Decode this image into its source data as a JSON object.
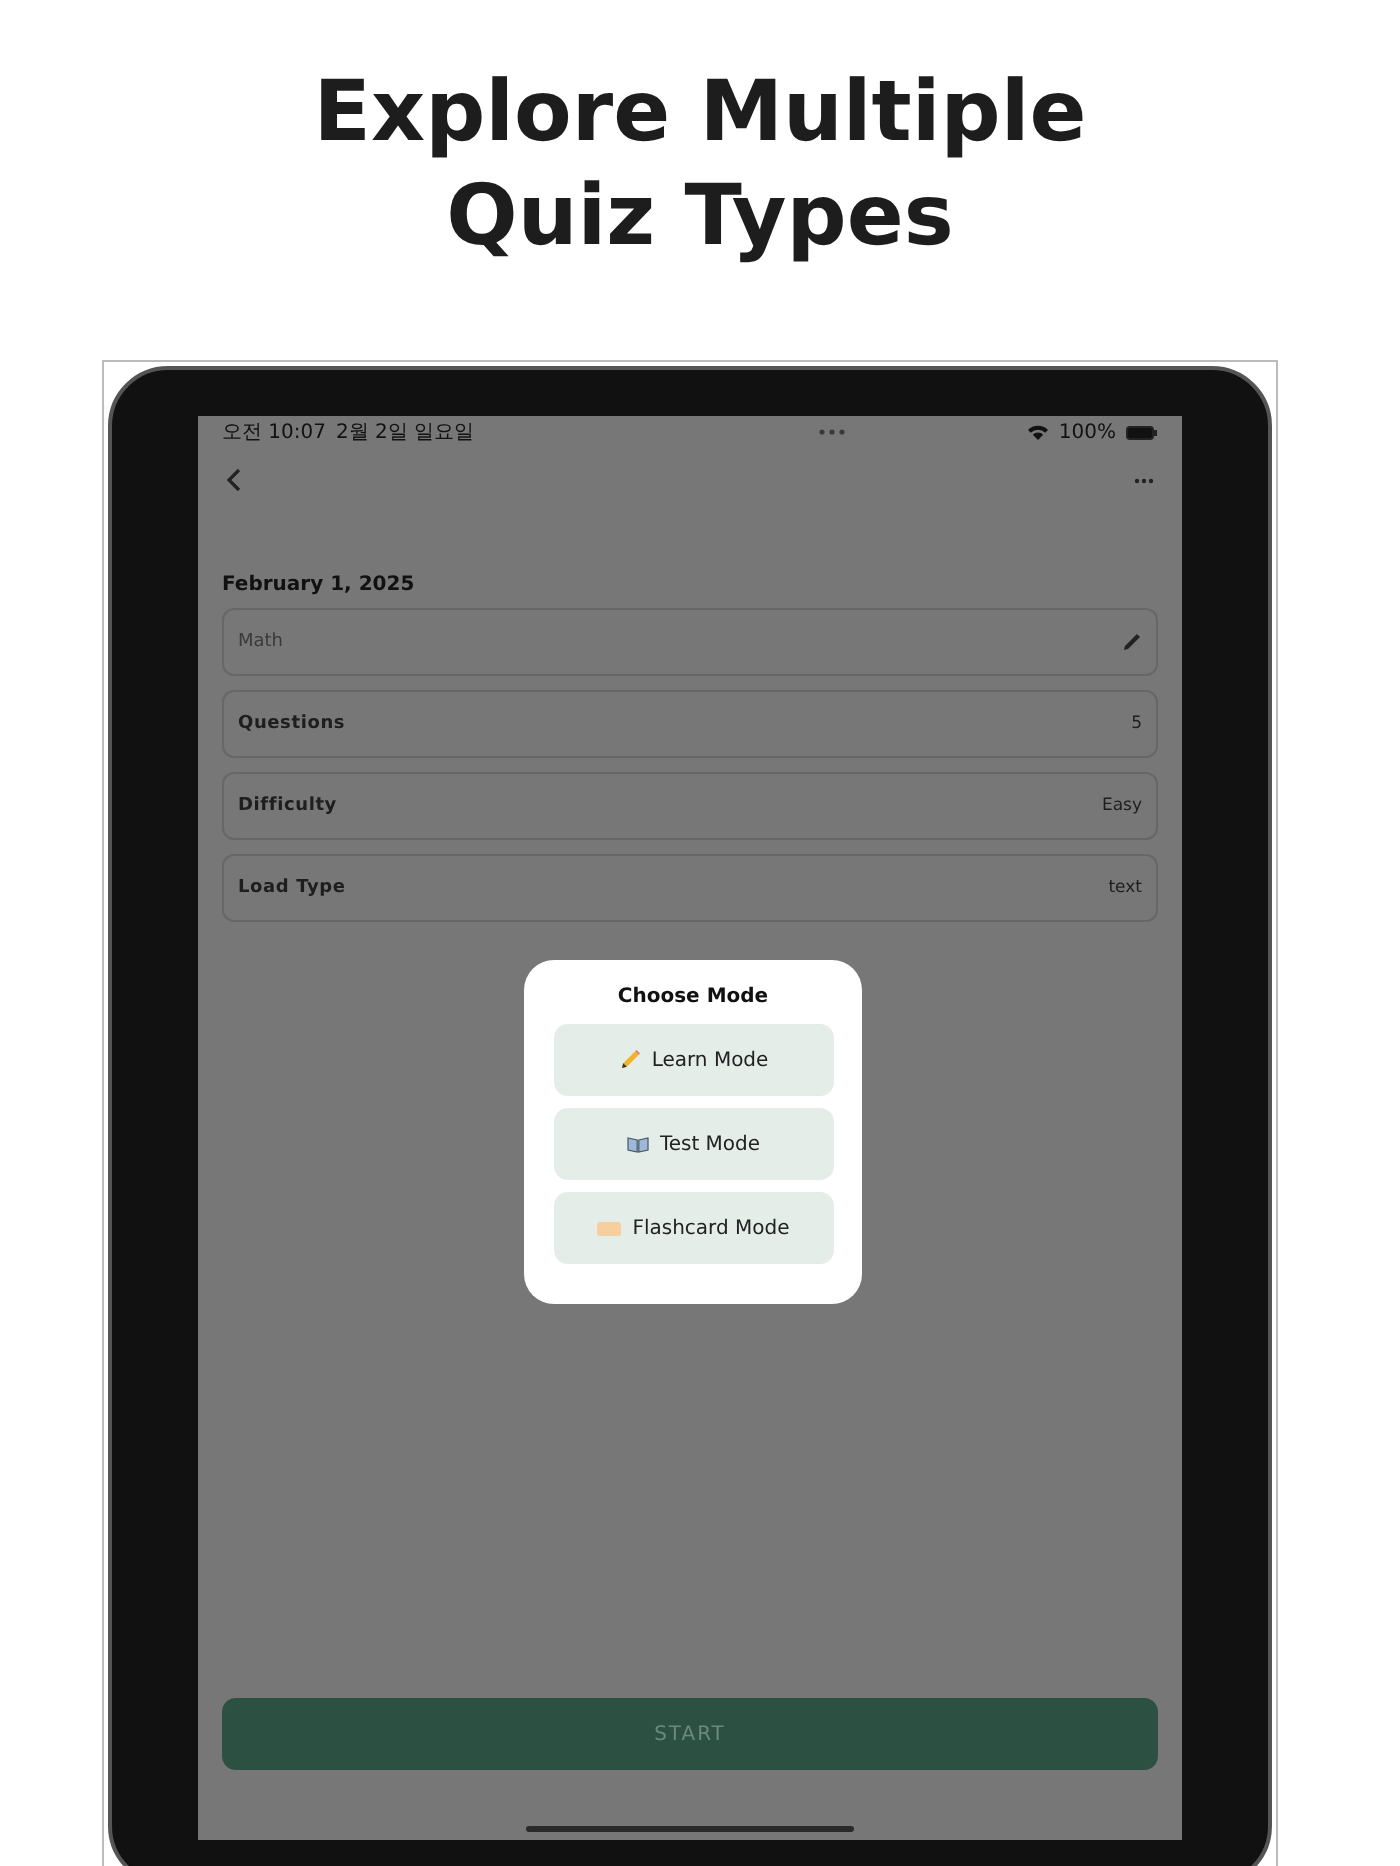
{
  "headline": [
    "Explore Multiple",
    "Quiz Types"
  ],
  "status_bar": {
    "time": "오전 10:07",
    "date": "2월 2일 일요일",
    "battery": "100%"
  },
  "date_heading": "February 1, 2025",
  "title_field": {
    "placeholder": "Math"
  },
  "settings": [
    {
      "label": "Questions",
      "value": "5"
    },
    {
      "label": "Difficulty",
      "value": "Easy"
    },
    {
      "label": "Load Type",
      "value": "text"
    }
  ],
  "modal": {
    "title": "Choose Mode",
    "options": [
      {
        "kind": "learn",
        "label": "Learn Mode"
      },
      {
        "kind": "test",
        "label": "Test Mode"
      },
      {
        "kind": "flashcard",
        "label": "Flashcard Mode"
      }
    ]
  },
  "start_button": "START"
}
